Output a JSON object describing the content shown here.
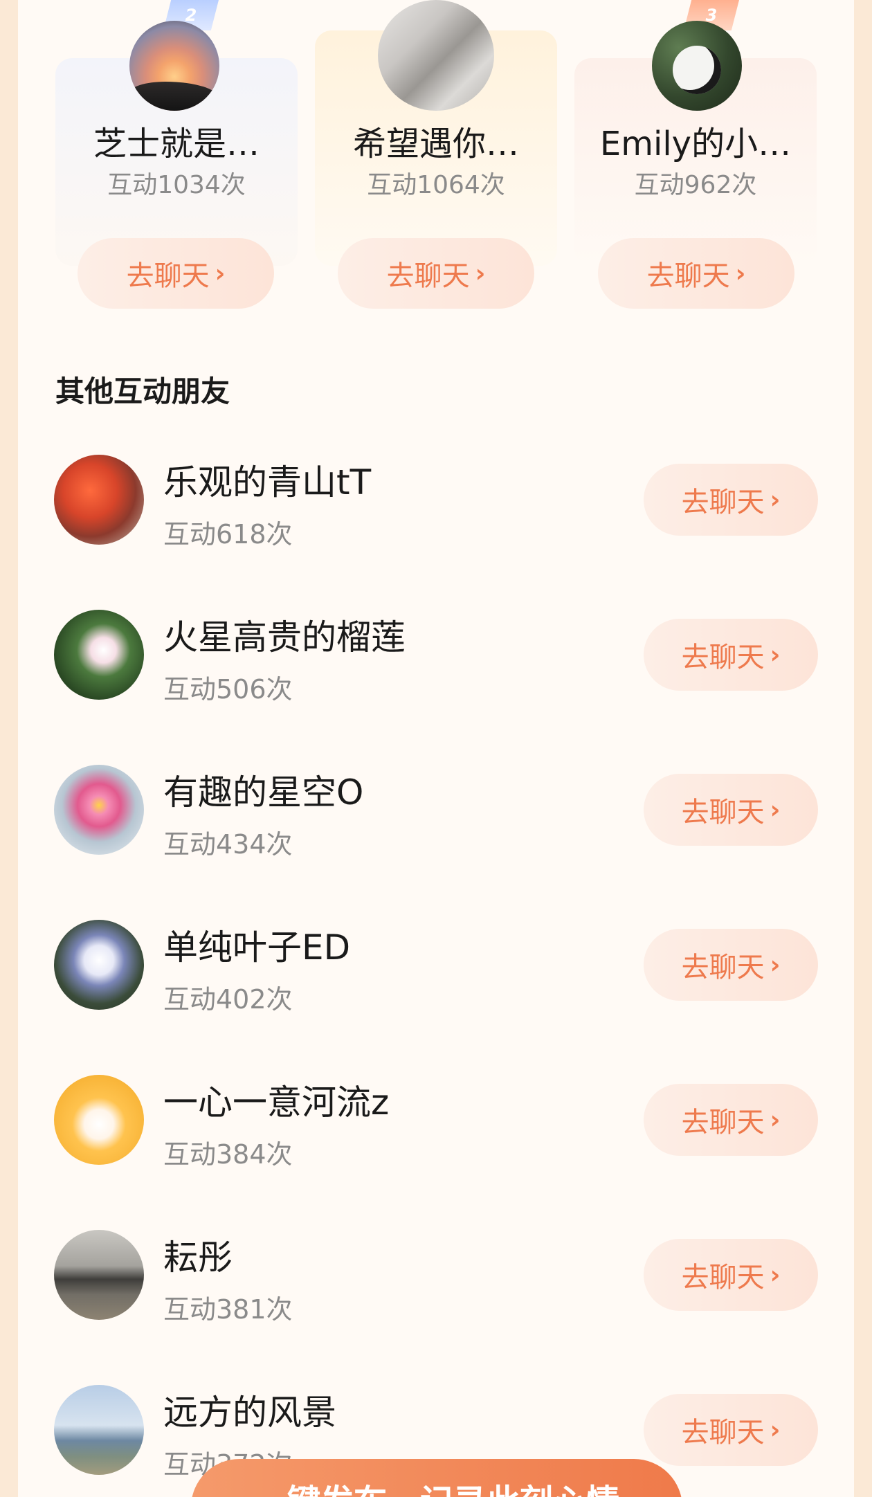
{
  "top_friends": [
    {
      "rank": "2",
      "name": "芝士就是…",
      "count": "互动1034次",
      "button": "去聊天"
    },
    {
      "rank": "",
      "name": "希望遇你…",
      "count": "互动1064次",
      "button": "去聊天"
    },
    {
      "rank": "3",
      "name": "Emily的小…",
      "count": "互动962次",
      "button": "去聊天"
    }
  ],
  "section_title": "其他互动朋友",
  "friends": [
    {
      "name": "乐观的青山tT",
      "count": "互动618次",
      "button": "去聊天"
    },
    {
      "name": "火星高贵的榴莲",
      "count": "互动506次",
      "button": "去聊天"
    },
    {
      "name": "有趣的星空O",
      "count": "互动434次",
      "button": "去聊天"
    },
    {
      "name": "单纯叶子ED",
      "count": "互动402次",
      "button": "去聊天"
    },
    {
      "name": "一心一意河流z",
      "count": "互动384次",
      "button": "去聊天"
    },
    {
      "name": "耘彤",
      "count": "互动381次",
      "button": "去聊天"
    },
    {
      "name": "远方的风景",
      "count": "互动372次",
      "button": "去聊天"
    }
  ],
  "cta_label": "一键发布，记录此刻心情",
  "icons": {
    "chevron": "chevron-right-icon"
  },
  "colors": {
    "accent": "#ee7a4d",
    "background": "#fffaf5",
    "frame": "#fbe9d6"
  }
}
